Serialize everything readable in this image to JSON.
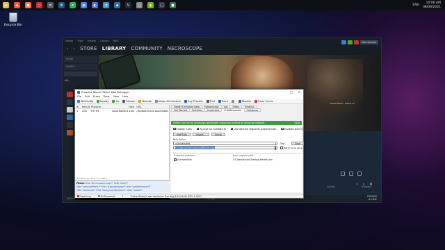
{
  "taskbar": {
    "icons": [
      {
        "name": "folder-icon",
        "color": "#e8b84a",
        "glyph": "▬"
      },
      {
        "name": "brave-icon",
        "color": "#fb542b",
        "glyph": "◆"
      },
      {
        "name": "firefox-icon",
        "color": "#ff7139",
        "glyph": "●"
      },
      {
        "name": "opera-icon",
        "color": "#d51f2f",
        "glyph": "○"
      },
      {
        "name": "app-icon",
        "color": "#555b66",
        "glyph": "≡"
      },
      {
        "name": "steam-icon",
        "color": "#1b5a8c",
        "glyph": "⚙"
      },
      {
        "name": "spotify-icon",
        "color": "#1db954",
        "glyph": "≋"
      },
      {
        "name": "chrome-icon",
        "color": "#4285f4",
        "glyph": "◉"
      },
      {
        "name": "discord-icon",
        "color": "#5865f2",
        "glyph": "◐"
      },
      {
        "name": "app2-icon",
        "color": "#2e9bdc",
        "glyph": "◔"
      },
      {
        "name": "fiddler-icon",
        "color": "#2b6cb0",
        "glyph": "◆"
      },
      {
        "name": "vscode-icon",
        "color": "#1f2b3a",
        "glyph": "V"
      },
      {
        "name": "app3-icon",
        "color": "#888",
        "glyph": "▯"
      },
      {
        "name": "nvidia-icon",
        "color": "#76b900",
        "glyph": "◈"
      },
      {
        "name": "app4-icon",
        "color": "#333a44",
        "glyph": "□"
      },
      {
        "name": "app5-icon",
        "color": "#2a7a3a",
        "glyph": "■"
      }
    ],
    "language": "ENG",
    "time": "10:06 AM",
    "date": "08/08/2021"
  },
  "desktop": {
    "recycle_bin_label": "Recycle Bin"
  },
  "steam": {
    "menu": [
      "Steam",
      "View",
      "Friends",
      "Games",
      "Help"
    ],
    "nav": {
      "back": "‹",
      "forward": "›",
      "store": "STORE",
      "library": "LIBRARY",
      "community": "COMMUNITY",
      "user": "NECROSCOPE"
    },
    "username": "Necroscope",
    "home": "HOME",
    "games": "GAMES",
    "all": "ALL",
    "hero_caption": "HAND WITH... NEAR TO",
    "tabs": [
      "Guides",
      "Support"
    ],
    "footer_add_game": "ADD A GAME",
    "footer_manage": "Manage",
    "footer_friends": "FRIENDS\n& CHAT"
  },
  "fiddler": {
    "title": "Progress Telerik Fiddler Web Debugger",
    "menu": [
      "File",
      "Edit",
      "Rules",
      "Tools",
      "View",
      "Help"
    ],
    "toolbar": [
      {
        "label": "WinConfig",
        "color": "#3a7bd5"
      },
      {
        "label": "Replay",
        "color": "#3aa03a"
      },
      {
        "label": "Go",
        "color": "#3aa03a"
      },
      {
        "label": "Stream",
        "color": "#555"
      },
      {
        "label": "Decode",
        "color": "#d9a400"
      },
      {
        "label": "Keep: All sessions",
        "color": "#888"
      },
      {
        "label": "Any Process",
        "color": "#2a66b8"
      },
      {
        "label": "Find",
        "color": "#555"
      },
      {
        "label": "Save",
        "color": "#2a66b8"
      },
      {
        "label": "",
        "color": "#888"
      },
      {
        "label": "Browse",
        "color": "#2a66b8"
      },
      {
        "label": "Clear Cache",
        "color": "#c33"
      }
    ],
    "sessions": {
      "columns": [
        "#",
        "Result",
        "Protocol",
        "Host",
        "URL"
      ],
      "rows": [
        {
          "num": "1",
          "result": "200",
          "protocol": "HTTPS",
          "host": "www.fiddler2.com",
          "url": "/UpdateCheck.aspx?isBet"
        }
      ]
    },
    "status_line": "(HTTPS/1.1) 200 4 / 1 / http://...",
    "filters": {
      "title": "Filters",
      "lines": [
        "Hide 'site-browser-page*'  Hide 'silent*'",
        "Hide 'seriouseffects.*'  Hide '#ganebrowser*'  Hide 'gamebrowser/*'",
        "Hide 'steamcdn*'  Hide 'backgroundbrowser*'  Hide 'fsdbcb*'"
      ]
    },
    "right_tabs_row1": [
      "Fiddler Orchestra Beta",
      "FiddlerScript",
      "Log",
      "Filters",
      "Timeline"
    ],
    "right_tabs_row2": [
      "Get Started",
      "Statistics",
      "Inspectors",
      "AutoResponder",
      "Composer"
    ],
    "banner": "Fiddler can return previously generated responses instead of using the network.",
    "banner_help": "Help",
    "options": [
      "Enable rules",
      "Accept all CONNECTs",
      "Unmatched requests passthrough",
      "Enable Latency"
    ],
    "options_checked": [
      true,
      false,
      true,
      false
    ],
    "buttons": [
      "Add Rule",
      "Import...",
      "Group"
    ],
    "rule_editor_label": "Rule Editor",
    "rule_match": "<Universities",
    "rule_response": "C:\\Users\\arcon\\Desktop\\Market.json",
    "test_label": "Test...",
    "save_label": "Save",
    "match_only_once": "Match only once",
    "table": {
      "headers": [
        "If request matches...",
        "then respond with..."
      ],
      "rows": [
        {
          "match": "<Universities",
          "respond": "C:\\Users\\arcon\\Desktop\\Market.json",
          "checked": true
        }
      ]
    },
    "bottom": {
      "capturing": "Capturing",
      "processes": "All Processes",
      "count": "1",
      "message": "CustomRules.js was loaded at: Sun Aug 8 10:04:42 UTC+1 2021"
    }
  }
}
